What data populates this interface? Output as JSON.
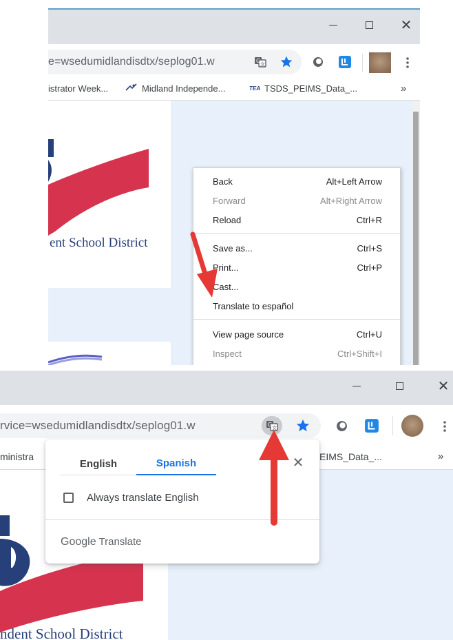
{
  "panel_top": {
    "window_controls": {
      "minimize": "–",
      "maximize": "☐",
      "close": "✕"
    },
    "address_bar": {
      "url_fragment": "e=wsedumidlandisdtx/seplog01.w"
    },
    "bookmarks": [
      {
        "label": "istrator Week..."
      },
      {
        "label": "Midland Independe..."
      },
      {
        "badge": "TEA",
        "label": "TSDS_PEIMS_Data_..."
      }
    ],
    "bookmarks_overflow": "»",
    "page": {
      "district_text": "ent School District"
    },
    "context_menu": {
      "items": [
        {
          "label": "Back",
          "shortcut": "Alt+Left Arrow",
          "disabled": false
        },
        {
          "label": "Forward",
          "shortcut": "Alt+Right Arrow",
          "disabled": true
        },
        {
          "label": "Reload",
          "shortcut": "Ctrl+R",
          "disabled": false
        },
        {
          "label": "Save as...",
          "shortcut": "Ctrl+S",
          "disabled": false
        },
        {
          "label": "Print...",
          "shortcut": "Ctrl+P",
          "disabled": false
        },
        {
          "label": "Cast...",
          "shortcut": "",
          "disabled": false
        },
        {
          "label": "Translate to español",
          "shortcut": "",
          "disabled": false
        },
        {
          "label": "View page source",
          "shortcut": "Ctrl+U",
          "disabled": false
        },
        {
          "label": "Inspect",
          "shortcut": "Ctrl+Shift+I",
          "disabled": true
        }
      ]
    }
  },
  "panel_bottom": {
    "window_controls": {
      "minimize": "–",
      "maximize": "☐",
      "close": "✕"
    },
    "address_bar": {
      "url_fragment": "rvice=wsedumidlandisdtx/seplog01.w"
    },
    "bookmarks": [
      {
        "label": "ministra"
      },
      {
        "label": "EIMS_Data_..."
      }
    ],
    "bookmarks_overflow": "»",
    "page": {
      "district_text": "ndent School District"
    },
    "translate_bubble": {
      "tabs": [
        {
          "label": "English",
          "active": false
        },
        {
          "label": "Spanish",
          "active": true
        }
      ],
      "close": "✕",
      "always_translate_label": "Always translate English",
      "always_translate_checked": false,
      "brand_google": "Google",
      "brand_translate": "Translate"
    }
  },
  "colors": {
    "accent_blue": "#1a73e8",
    "logo_red": "#d6334f",
    "logo_navy": "#27407a",
    "arrow_red": "#e53935",
    "page_bg": "#e8f0fb"
  },
  "icons": {
    "translate": "translate-icon",
    "bookmark_star": "star-icon",
    "extension_circle": "circle-extension-icon",
    "extension_blue": "blue-extension-icon",
    "profile": "avatar",
    "menu": "kebab-menu-icon"
  }
}
